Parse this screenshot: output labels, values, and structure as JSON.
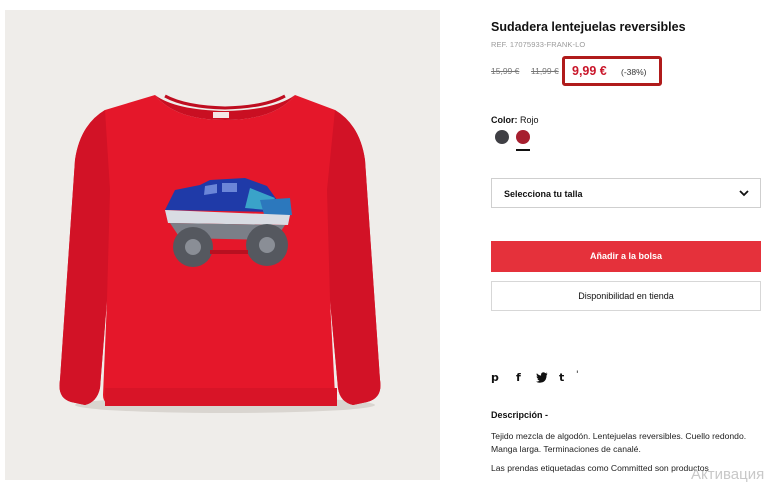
{
  "product": {
    "title": "Sudadera lentejuelas reversibles",
    "ref": "REF. 17075933-FRANK-LO",
    "old_price_1": "15,99 €",
    "old_price_2": "11,99 €",
    "price": "9,99 €",
    "discount": "(-38%)",
    "image_icon": "red-sweatshirt-sequin-truck-image"
  },
  "color": {
    "label": "Color:",
    "value": "Rojo",
    "swatches": [
      "#3f3f44",
      "#a61f2f"
    ]
  },
  "size_select": {
    "label": "Selecciona tu talla",
    "icon": "chevron-down-icon"
  },
  "buttons": {
    "add_to_bag": "Añadir a la bolsa",
    "store_availability": "Disponibilidad en tienda"
  },
  "share": {
    "icons": [
      "pinterest-icon",
      "facebook-icon",
      "twitter-icon",
      "tumblr-icon"
    ],
    "pinterest": "p",
    "facebook": "f",
    "tumblr": "t",
    "extra": "'"
  },
  "description": {
    "title": "Descripción -",
    "text": "Tejido mezcla de algodón. Lentejuelas reversibles. Cuello redondo. Manga larga. Terminaciones de canalé.",
    "text2": "Las prendas etiquetadas como Committed son productos"
  },
  "overlay": {
    "watermark": "Активация"
  },
  "colors": {
    "accent": "#e5313b",
    "price_red": "#c9162a",
    "highlight_box": "#b01b1b"
  }
}
